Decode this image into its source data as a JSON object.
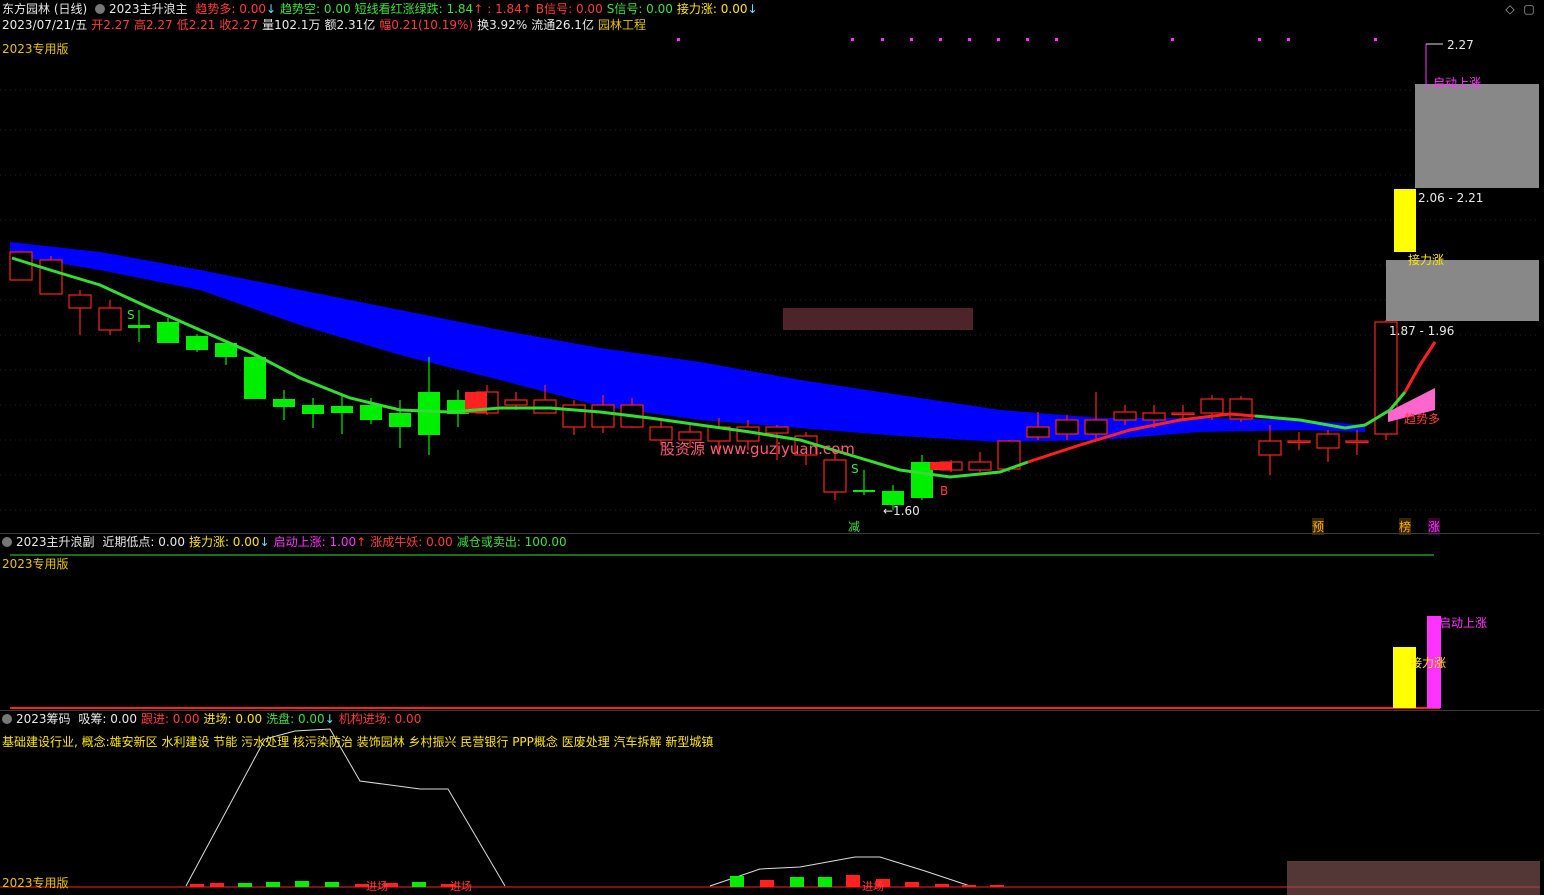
{
  "header_main": {
    "title": "东方园林 (日线)",
    "indicator": "2023主升浪主",
    "items": [
      {
        "label": "趋势多: 0.00",
        "color": "#ff3b3b",
        "arrow": "↓"
      },
      {
        "label": "趋势空: 0.00",
        "color": "#3ee03e",
        "arrow": ""
      },
      {
        "label": "短线看红涨绿跌: 1.84",
        "color": "#3ee03e",
        "arrow": "↑"
      },
      {
        "label": ": 1.84",
        "color": "#ff3b3b",
        "arrow": "↑"
      },
      {
        "label": "B信号: 0.00",
        "color": "#ff3b3b",
        "arrow": ""
      },
      {
        "label": "S信号: 0.00",
        "color": "#3ee03e",
        "arrow": ""
      },
      {
        "label": "接力涨: 0.00",
        "color": "#ffe600",
        "arrow": "↓"
      }
    ]
  },
  "quote_line": {
    "date": "2023/07/21/五",
    "open": "开2.27",
    "high": "高2.27",
    "low": "低2.21",
    "close": "收2.27",
    "volume": "量102.1万",
    "amount": "额2.31亿",
    "change": "幅0.21(10.19%)",
    "turnover": "换3.92%",
    "float_cap": "流通26.1亿",
    "sector": "园林工程"
  },
  "version_label": "2023专用版",
  "main_chart": {
    "annotations": {
      "high_price": "2.27",
      "start_rise_top": "启动上涨",
      "range_upper": "2.06 - 2.21",
      "relay_rise": "接力涨",
      "range_lower": "1.87 - 1.96",
      "trend_long": "趋势多",
      "low_price": "←1.60",
      "sig_s1": "S",
      "sig_s2": "S",
      "sig_b": "B",
      "watermark": "股资源 www.guziyuan.com"
    },
    "bottom_marks": [
      {
        "text": "减",
        "color": "#3ee03e"
      },
      {
        "text": "预",
        "color": "#ffb000"
      },
      {
        "text": "榜",
        "color": "#ffb000"
      },
      {
        "text": "涨",
        "color": "#ff33ff"
      }
    ]
  },
  "header_sub": {
    "indicator": "2023主升浪副",
    "items": [
      {
        "label": "近期低点: 0.00",
        "color": "#e8e8e8",
        "arrow": ""
      },
      {
        "label": "接力涨: 0.00",
        "color": "#ffe600",
        "arrow": "↓"
      },
      {
        "label": "启动上涨: 1.00",
        "color": "#ff33ff",
        "arrow": "↑"
      },
      {
        "label": "涨成牛妖: 0.00",
        "color": "#ff3b3b",
        "arrow": ""
      },
      {
        "label": "减仓或卖出: 100.00",
        "color": "#3ee03e",
        "arrow": ""
      }
    ],
    "labels": {
      "start_rise": "启动上涨",
      "relay": "接力涨"
    }
  },
  "header_chip": {
    "indicator": "2023筹码",
    "items": [
      {
        "label": "吸筹: 0.00",
        "color": "#e8e8e8",
        "arrow": ""
      },
      {
        "label": "跟进: 0.00",
        "color": "#ff3b3b",
        "arrow": ""
      },
      {
        "label": "进场: 0.00",
        "color": "#ffe600",
        "arrow": ""
      },
      {
        "label": "洗盘: 0.00",
        "color": "#3ee03e",
        "arrow": "↓"
      },
      {
        "label": "机构进场: 0.00",
        "color": "#ff3b3b",
        "arrow": ""
      }
    ],
    "concepts": "基础建设行业, 概念:雄安新区 水利建设 节能 污水处理 核污染防治 装饰园林 乡村振兴 民营银行 PPP概念 医废处理 汽车拆解 新型城镇",
    "bottom_label": "2023专用版",
    "bar_labels": {
      "l1": "进场",
      "l2": "进场",
      "l3": "进场"
    }
  },
  "controls": {
    "diamond": "◇",
    "restore": "▢"
  },
  "colors": {
    "up": "#ff2020",
    "down": "#00ee00",
    "band": "#0000ff",
    "ma": "#33dd33"
  }
}
